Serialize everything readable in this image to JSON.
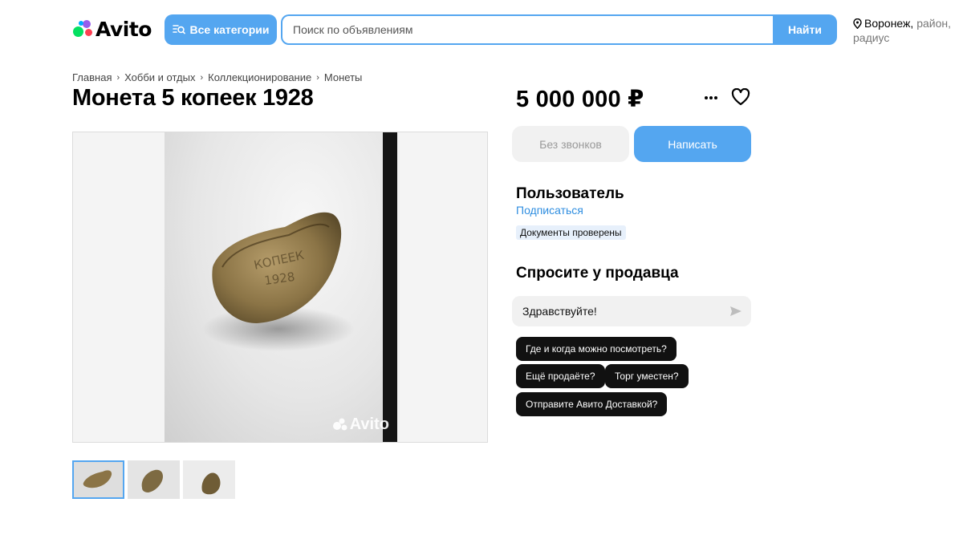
{
  "colors": {
    "accent": "#54a6f0",
    "accent_dark": "#2f8ee0"
  },
  "header": {
    "logo_text": "Avito",
    "categories_label": "Все категории",
    "search_placeholder": "Поиск по объявлениям",
    "search_button": "Найти",
    "location_city": "Воронеж,",
    "location_rest": "район, радиус"
  },
  "breadcrumb": [
    "Главная",
    "Хобби и отдых",
    "Коллекционирование",
    "Монеты"
  ],
  "listing": {
    "title": "Монета 5 копеек 1928",
    "price": "5 000 000 ₽",
    "watermark": "Avito",
    "thumbnail_count": 3
  },
  "actions": {
    "no_calls_label": "Без звонков",
    "write_label": "Написать"
  },
  "seller": {
    "name": "Пользователь",
    "subscribe_label": "Подписаться",
    "badge": "Документы проверены"
  },
  "ask": {
    "title": "Спросите у продавца",
    "message_value": "Здравствуйте!",
    "suggestions": [
      "Где и когда можно посмотреть?",
      "Ещё продаёте?",
      "Торг уместен?",
      "Отправите Авито Доставкой?"
    ]
  },
  "icons": [
    "category-search-icon",
    "location-pin-icon",
    "more-dots-icon",
    "heart-icon",
    "send-icon"
  ]
}
